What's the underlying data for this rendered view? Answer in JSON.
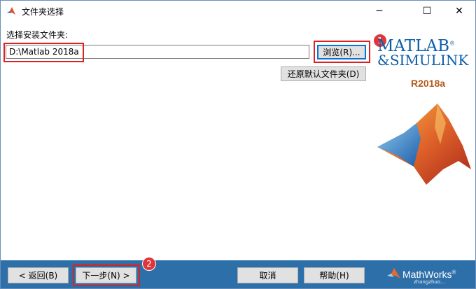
{
  "window": {
    "title": "文件夹选择",
    "minimize_glyph": "─",
    "maximize_glyph": "☐",
    "close_glyph": "✕"
  },
  "install": {
    "label": "选择安装文件夹:",
    "path_value": "D:\\Matlab 2018a",
    "browse_label": "浏览(R)...",
    "restore_label": "还原默认文件夹(D)"
  },
  "badges": {
    "one": "1",
    "two": "2"
  },
  "logo": {
    "line1": "MATLAB",
    "line2": "SIMULINK",
    "mark1": "®",
    "version": "R2018a"
  },
  "footer": {
    "back_label": "< 返回(B)",
    "next_label": "下一步(N) >",
    "cancel_label": "取消",
    "help_label": "帮助(H)",
    "brand": "MathWorks",
    "brand_mark": "®",
    "watermark": "zhangzhuo..."
  },
  "colors": {
    "footer_bg": "#2d6fa8",
    "highlight": "#e02020",
    "badge": "#e0363b",
    "logo_blue": "#0b5ea8",
    "version_orange": "#b35a1c"
  }
}
